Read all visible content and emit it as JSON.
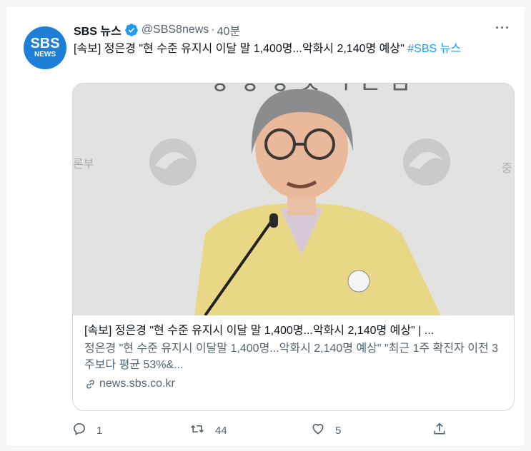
{
  "tweet": {
    "avatar_line1": "SBS",
    "avatar_line2": "NEWS",
    "name": "SBS 뉴스",
    "handle": "@SBS8news",
    "separator": "·",
    "time": "40분",
    "more": "···",
    "text": "[속보] 정은경 \"현 수준 유지시 이달 말 1,400명...악화시 2,140명 예상\" ",
    "hashtag": "#SBS 뉴스"
  },
  "card": {
    "title": "[속보] 정은경 \"현 수준 유지시 이달 말 1,400명...악화시 2,140명 예상\" | ...",
    "description": "정은경 \"현 수준 유지시 이달말 1,400명...악화시 2,140명 예상\" \"최근 1주 확진자 이전 3주보다 평균 53%&...",
    "domain": "news.sbs.co.kr"
  },
  "actions": {
    "reply_count": "1",
    "retweet_count": "44",
    "like_count": "5"
  },
  "colors": {
    "accent": "#1d9bf0",
    "avatar_bg": "#1d7fd8",
    "secondary_text": "#536471",
    "jacket": "#e8d785"
  }
}
